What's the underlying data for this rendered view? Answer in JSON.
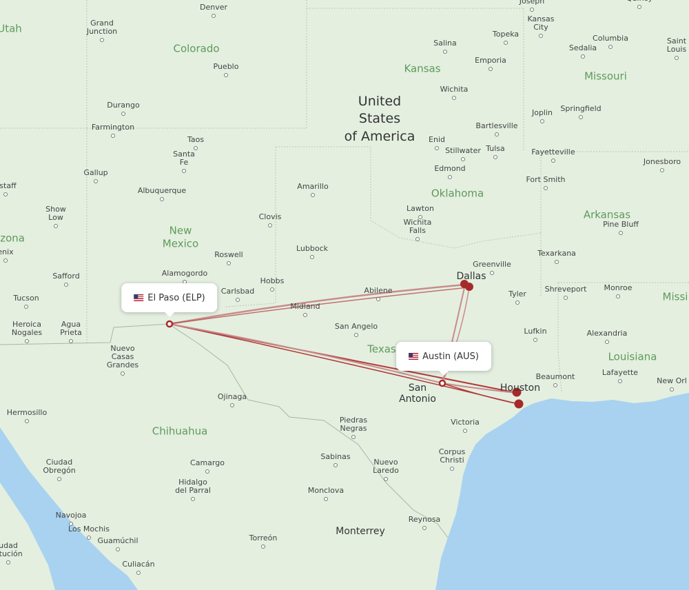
{
  "map": {
    "colors": {
      "land": "#e4efe0",
      "water": "#a8d2f0",
      "route": "#b03a3a",
      "route_light": "#c98b8b",
      "endpoint": "#a62a2a"
    },
    "airports": [
      {
        "code": "ELP",
        "label": "El Paso (ELP)",
        "country_flag": "us-flag"
      },
      {
        "code": "AUS",
        "label": "Austin (AUS)",
        "country_flag": "us-flag"
      }
    ],
    "destinations": [
      "Dallas",
      "Houston"
    ],
    "country_labels": [
      "United",
      "States",
      "of America"
    ],
    "state_labels": [
      {
        "name": "Utah"
      },
      {
        "name": "Colorado"
      },
      {
        "name": "Kansas"
      },
      {
        "name": "Missouri"
      },
      {
        "name": "New"
      },
      {
        "name": "Mexico"
      },
      {
        "name": "Oklahoma"
      },
      {
        "name": "Arkansas"
      },
      {
        "name": "Texas"
      },
      {
        "name": "Louisiana"
      },
      {
        "name": "Chihuahua"
      },
      {
        "name": "izona"
      },
      {
        "name": "Missi"
      }
    ],
    "cities": [
      "Denver",
      "Saint Joseph",
      "Quincy",
      "Grand Junction",
      "Kansas City",
      "Topeka",
      "Columbia",
      "Sedalia",
      "Saint Louis",
      "Salina",
      "Emporia",
      "Pueblo",
      "Wichita",
      "Durango",
      "Springfield",
      "Joplin",
      "Farmington",
      "Bartlesville",
      "Taos",
      "Enid",
      "Tulsa",
      "Stillwater",
      "Santa Fe",
      "Fayetteville",
      "Jonesboro",
      "Gallup",
      "Edmond",
      "Fort Smith",
      "Albuquerque",
      "Amarillo",
      "gstaff",
      "Show Low",
      "Clovis",
      "Lawton",
      "Wichita Falls",
      "Pine Bluff",
      "enix",
      "Lubbock",
      "Roswell",
      "Greenville",
      "Texarkana",
      "Safford",
      "Alamogordo",
      "Hobbs",
      "Carlsbad",
      "Abilene",
      "Dallas",
      "Tyler",
      "Shreveport",
      "Monroe",
      "Tucson",
      "Midland",
      "Heroica Nogales",
      "Agua Prieta",
      "San Angelo",
      "Lufkin",
      "Alexandria",
      "Nuevo Casas Grandes",
      "Beaumont",
      "Lafayette",
      "New Orl",
      "Houston",
      "San Antonio",
      "Ojinaga",
      "Hermosillo",
      "Victoria",
      "Piedras Negras",
      "Corpus Christi",
      "Ciudad Obregón",
      "Camargo",
      "Sabinas",
      "Nuevo Laredo",
      "Hidalgo del Parral",
      "Monclova",
      "Navojoa",
      "Los Mochis",
      "Reynosa",
      "Guamúchil",
      "Monterrey",
      "Torreón",
      "Culiacán",
      "Ciudad Constitución"
    ]
  }
}
